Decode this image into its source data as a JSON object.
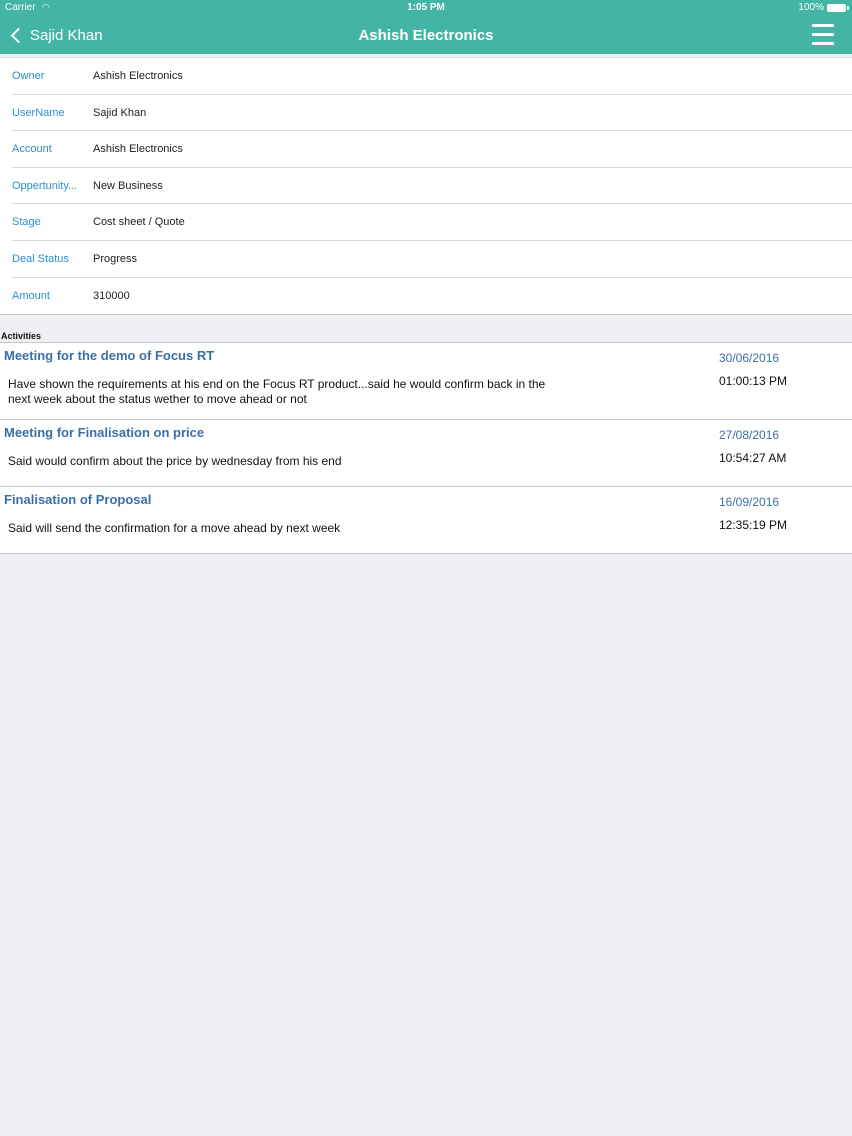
{
  "status_bar": {
    "carrier": "Carrier",
    "time": "1:05 PM",
    "battery": "100%"
  },
  "nav": {
    "back_label": "Sajid Khan",
    "title": "Ashish Electronics"
  },
  "details": [
    {
      "label": "Owner",
      "value": "Ashish Electronics"
    },
    {
      "label": "UserName",
      "value": "Sajid Khan"
    },
    {
      "label": "Account",
      "value": "Ashish Electronics"
    },
    {
      "label": "Oppertunity...",
      "value": "New Business"
    },
    {
      "label": "Stage",
      "value": "Cost sheet / Quote"
    },
    {
      "label": "Deal Status",
      "value": "Progress"
    },
    {
      "label": "Amount",
      "value": "310000"
    }
  ],
  "activities_header": "Activities",
  "activities": [
    {
      "title": "Meeting for the demo of Focus RT",
      "description": "Have shown the requirements at his end on the Focus RT product...said he would confirm back in the next week about the status wether to move ahead or not",
      "date": "30/06/2016",
      "time": "01:00:13 PM"
    },
    {
      "title": "Meeting for Finalisation on price",
      "description": "Said would confirm about the price by wednesday from his end",
      "date": "27/08/2016",
      "time": "10:54:27 AM"
    },
    {
      "title": "Finalisation of Proposal",
      "description": "Said will send the confirmation for a move ahead by next week",
      "date": "16/09/2016",
      "time": "12:35:19 PM"
    }
  ]
}
